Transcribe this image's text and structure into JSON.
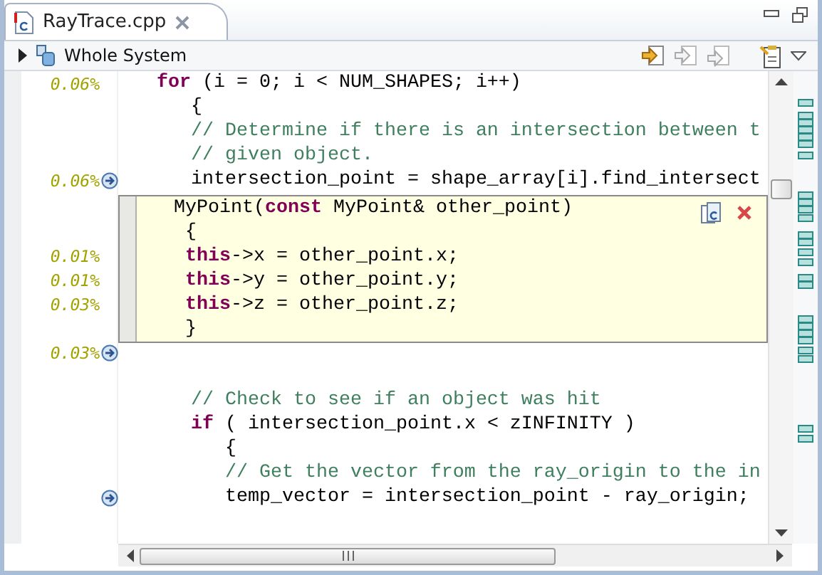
{
  "tab": {
    "title": "RayTrace.cpp",
    "selected": true
  },
  "toolbar": {
    "scope": "Whole System"
  },
  "lines": [
    {
      "kind": "code",
      "percent": "0.06%",
      "arrow": false,
      "segments": [
        {
          "kind": "kw",
          "text": "for"
        },
        {
          "kind": "plain",
          "text": " (i = 0; i < NUM_SHAPES; i++)"
        }
      ]
    },
    {
      "kind": "code",
      "arrow": false,
      "segments": [
        {
          "kind": "plain",
          "text": "{"
        }
      ]
    },
    {
      "kind": "code",
      "arrow": false,
      "segments": [
        {
          "kind": "comment",
          "text": "// Determine if there is an intersection between t"
        }
      ]
    },
    {
      "kind": "code",
      "arrow": false,
      "segments": [
        {
          "kind": "comment",
          "text": "// given object."
        }
      ]
    },
    {
      "kind": "code",
      "percent": "0.06%",
      "arrow": true,
      "segments": [
        {
          "kind": "plain",
          "text": "intersection_point = shape_array[i].find_intersect"
        }
      ]
    },
    {
      "kind": "popup",
      "lines": [
        {
          "segments": [
            {
              "kind": "plain",
              "text": "MyPoint("
            },
            {
              "kind": "kw",
              "text": "const"
            },
            {
              "kind": "plain",
              "text": " MyPoint& other_point)"
            }
          ]
        },
        {
          "segments": [
            {
              "kind": "plain",
              "text": "{"
            }
          ]
        },
        {
          "percent": "0.01%",
          "segments": [
            {
              "kind": "kw",
              "text": "this"
            },
            {
              "kind": "plain",
              "text": "->x = other_point.x;"
            }
          ]
        },
        {
          "percent": "0.01%",
          "segments": [
            {
              "kind": "kw",
              "text": "this"
            },
            {
              "kind": "plain",
              "text": "->y = other_point.y;"
            }
          ]
        },
        {
          "percent": "0.03%",
          "segments": [
            {
              "kind": "kw",
              "text": "this"
            },
            {
              "kind": "plain",
              "text": "->z = other_point.z;"
            }
          ]
        },
        {
          "segments": [
            {
              "kind": "plain",
              "text": "}"
            }
          ]
        }
      ]
    },
    {
      "kind": "code",
      "percent": "0.03%",
      "arrow": true
    },
    {
      "kind": "blank"
    },
    {
      "kind": "code",
      "arrow": false,
      "segments": [
        {
          "kind": "comment",
          "text": "// Check to see if an object was hit"
        }
      ]
    },
    {
      "kind": "code",
      "arrow": false,
      "segments": [
        {
          "kind": "kw",
          "text": "if"
        },
        {
          "kind": "plain",
          "text": " ( intersection_point.x < zINFINITY )"
        }
      ]
    },
    {
      "kind": "code",
      "arrow": false,
      "segments": [
        {
          "kind": "plain",
          "text": "{"
        }
      ]
    },
    {
      "kind": "code",
      "arrow": false,
      "segments": [
        {
          "kind": "comment",
          "text": "// Get the vector from the ray_origin to the in"
        }
      ]
    },
    {
      "kind": "code",
      "arrow": true,
      "segments": [
        {
          "kind": "plain",
          "text": "temp_vector = intersection_point - ray_origin;"
        }
      ]
    }
  ]
}
